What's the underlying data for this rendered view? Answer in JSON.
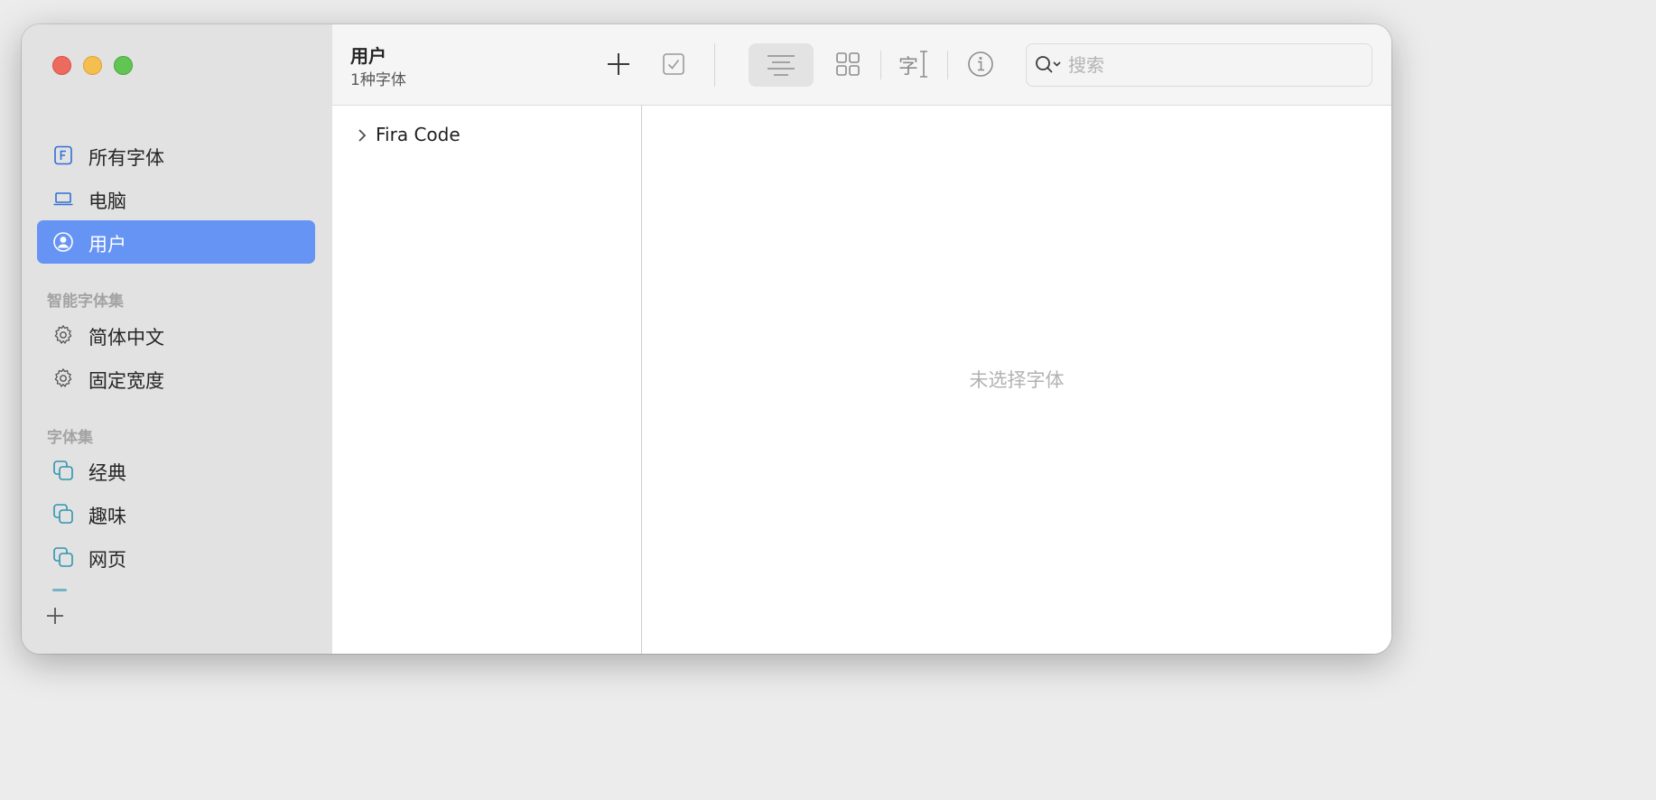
{
  "window": {
    "traffic_lights": [
      "close",
      "minimize",
      "zoom"
    ]
  },
  "sidebar": {
    "library_items": [
      {
        "label": "所有字体",
        "icon": "all-fonts-icon",
        "selected": false
      },
      {
        "label": "电脑",
        "icon": "computer-icon",
        "selected": false
      },
      {
        "label": "用户",
        "icon": "user-icon",
        "selected": true
      }
    ],
    "smart_collections_heading": "智能字体集",
    "smart_collections": [
      {
        "label": "简体中文",
        "icon": "gear-icon"
      },
      {
        "label": "固定宽度",
        "icon": "gear-icon"
      }
    ],
    "collections_heading": "字体集",
    "collections": [
      {
        "label": "经典",
        "icon": "collection-icon"
      },
      {
        "label": "趣味",
        "icon": "collection-icon"
      },
      {
        "label": "网页",
        "icon": "collection-icon"
      }
    ],
    "add_icon": "plus-icon"
  },
  "toolbar": {
    "title": "用户",
    "subtitle": "1种字体",
    "buttons": [
      "plus-icon",
      "checkbox-icon",
      "list-view-icon",
      "grid-view-icon",
      "sample-text-icon",
      "info-icon"
    ],
    "search_placeholder": "搜索"
  },
  "font_list": [
    {
      "name": "Fira Code",
      "expanded": false
    }
  ],
  "preview": {
    "empty_message": "未选择字体"
  },
  "colors": {
    "selection": "#6694f5",
    "sidebar_bg": "#e2e2e2",
    "icon_blue": "#2f6fd6",
    "icon_teal": "#2f94b0"
  }
}
